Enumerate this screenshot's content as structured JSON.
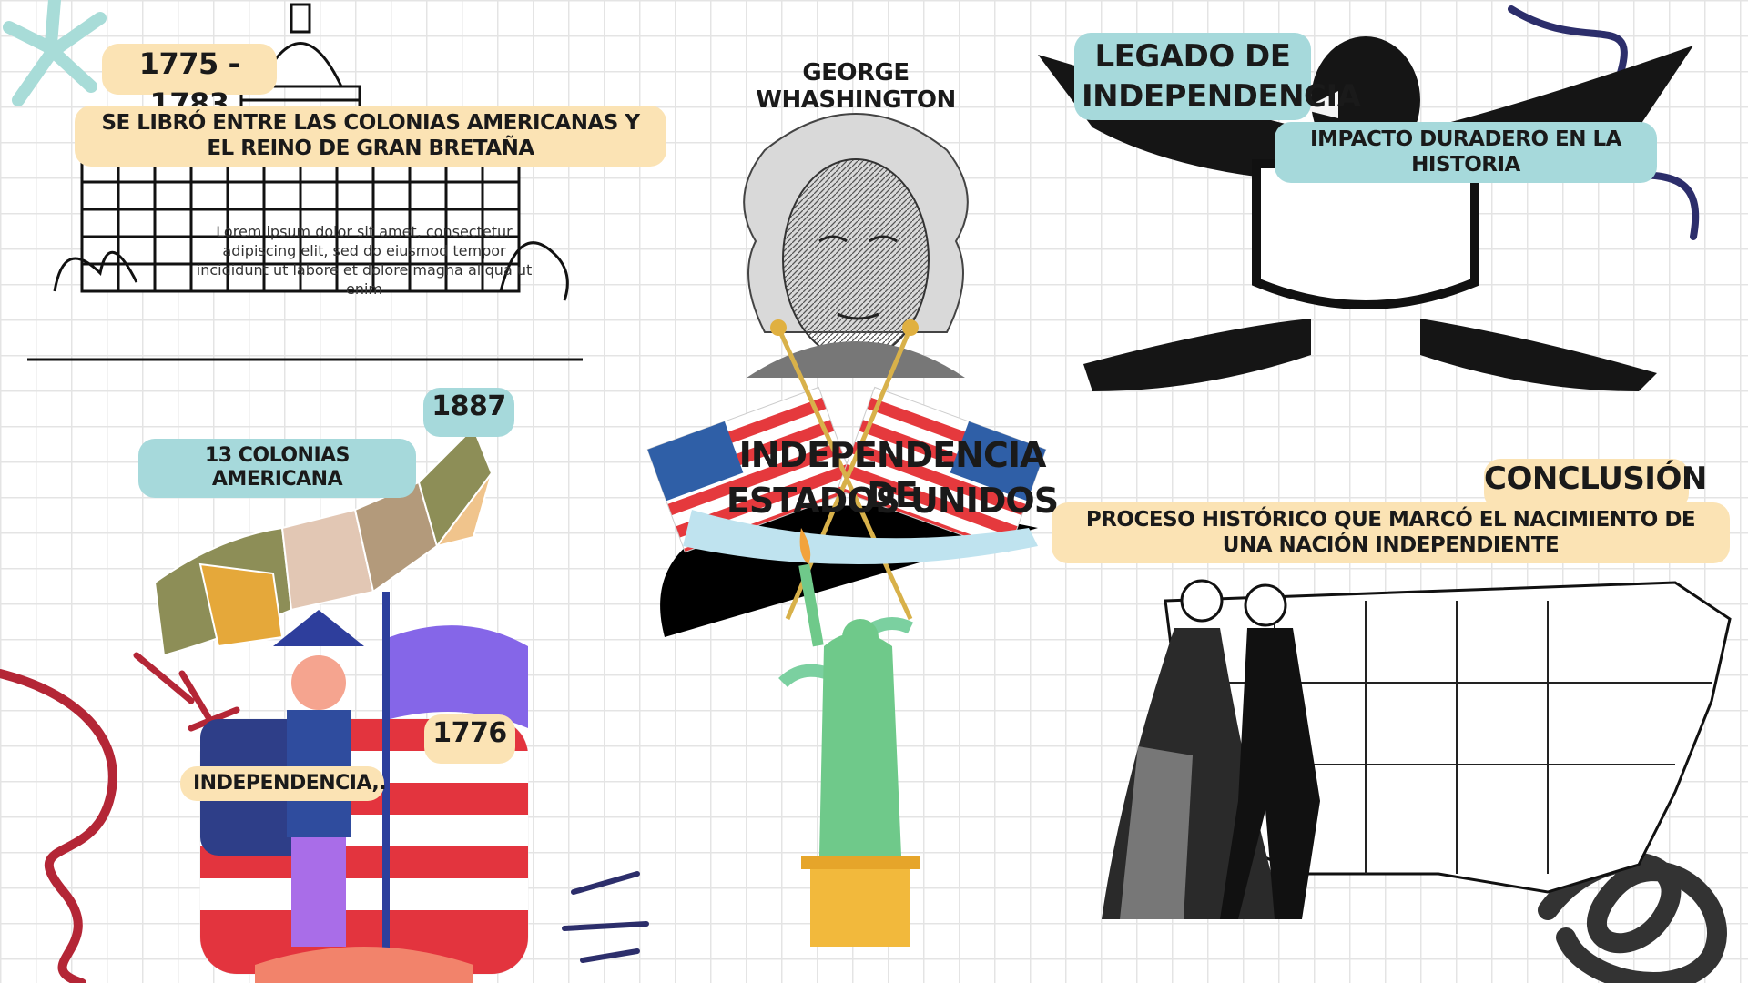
{
  "colors": {
    "tan": "#fbe3b4",
    "aqua": "#a6d9db",
    "ink": "#1a1a1a"
  },
  "timeline": {
    "years_1775": "1775 - 1783",
    "war_desc": "SE LIBRÓ ENTRE LAS COLONIAS AMERICANAS Y EL REINO DE GRAN BRETAÑA",
    "lorem": "Lorem ipsum dolor sit amet, consectetur adipiscing elit, sed do eiusmod tempor incididunt ut labore et dolore magna aliqua ut enim",
    "year_1887": "1887",
    "colonies": "13 COLONIAS AMERICANA",
    "year_1776": "1776",
    "independence": "INDEPENDENCIA,."
  },
  "center": {
    "washington": "GEORGE WHASHINGTON",
    "title_line1": "INDEPENDENCIA DE",
    "title_line2": "ESTADOS UNIDOS"
  },
  "legacy": {
    "title_line1": "LEGADO DE",
    "title_line2": "INDEPENDENCIA",
    "impact": "IMPACTO DURADERO EN LA HISTORIA"
  },
  "conclusion": {
    "title": "CONCLUSIÓN",
    "text": "PROCESO HISTÓRICO QUE MARCÓ EL NACIMIENTO DE UNA NACIÓN INDEPENDIENTE"
  },
  "icons": [
    "capitol-illustration",
    "washington-portrait",
    "crossed-flags-icon",
    "eagle-crest-illustration",
    "colonies-map",
    "soldier-illustration",
    "statue-of-liberty",
    "colonial-couple-illustration",
    "usa-map"
  ]
}
